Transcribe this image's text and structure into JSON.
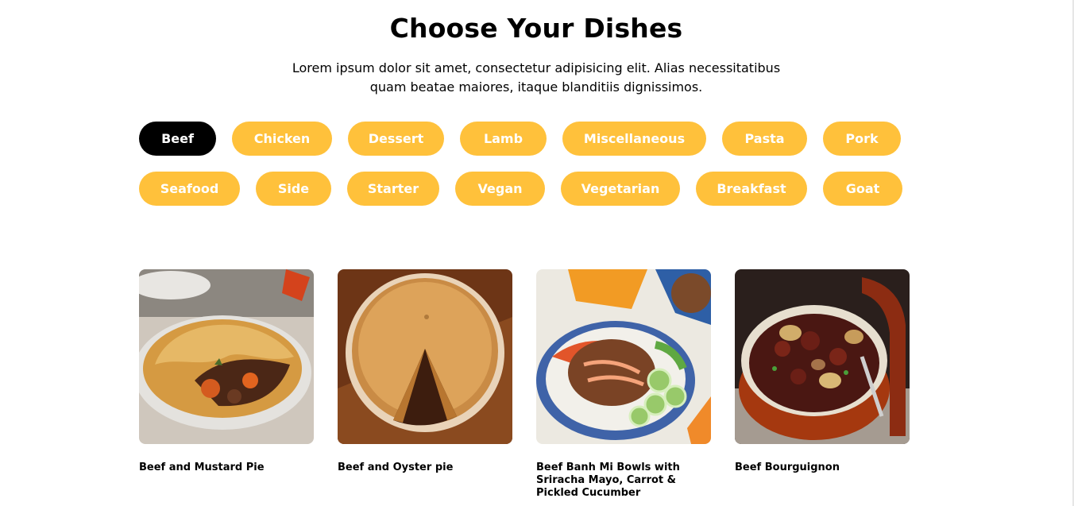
{
  "header": {
    "title": "Choose Your Dishes",
    "subtitle": "Lorem ipsum dolor sit amet, consectetur adipisicing elit. Alias necessitatibus quam beatae maiores, itaque blanditiis dignissimos."
  },
  "categories": [
    {
      "label": "Beef",
      "active": true
    },
    {
      "label": "Chicken"
    },
    {
      "label": "Dessert"
    },
    {
      "label": "Lamb"
    },
    {
      "label": "Miscellaneous"
    },
    {
      "label": "Pasta"
    },
    {
      "label": "Pork"
    },
    {
      "label": "Seafood"
    },
    {
      "label": "Side"
    },
    {
      "label": "Starter"
    },
    {
      "label": "Vegan"
    },
    {
      "label": "Vegetarian"
    },
    {
      "label": "Breakfast"
    },
    {
      "label": "Goat"
    }
  ],
  "dishes": [
    {
      "name": "Beef and Mustard Pie"
    },
    {
      "name": "Beef and Oyster pie"
    },
    {
      "name": "Beef Banh Mi Bowls with Sriracha Mayo, Carrot & Pickled Cucumber"
    },
    {
      "name": "Beef Bourguignon"
    }
  ],
  "colors": {
    "accent": "#ffc13b",
    "active": "#000000",
    "pill_text": "#ffffff"
  }
}
